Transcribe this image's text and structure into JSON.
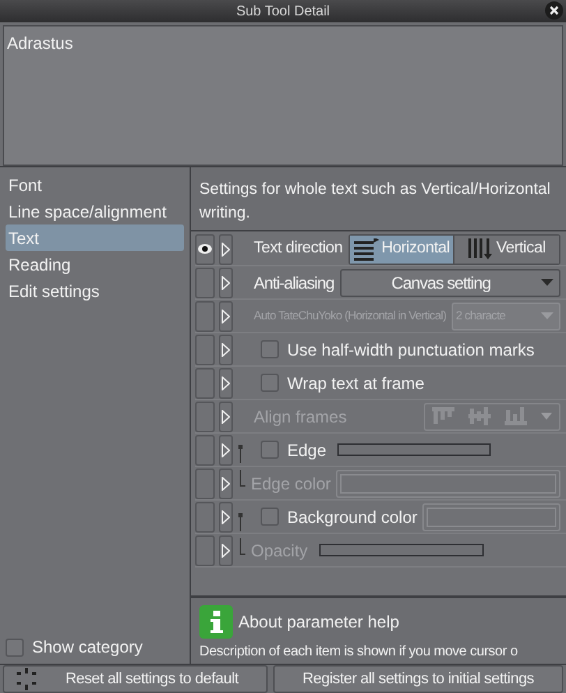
{
  "window": {
    "title": "Sub Tool Detail"
  },
  "preview": {
    "name": "Adrastus"
  },
  "categories": [
    {
      "label": "Font",
      "selected": false
    },
    {
      "label": "Line space/alignment",
      "selected": false
    },
    {
      "label": "Text",
      "selected": true
    },
    {
      "label": "Reading",
      "selected": false
    },
    {
      "label": "Edit settings",
      "selected": false
    }
  ],
  "show_category": {
    "label": "Show category",
    "checked": false
  },
  "description": "Settings for whole text such as Vertical/Horizontal writing.",
  "settings": [
    {
      "kind": "segmented",
      "label": "Text direction",
      "visible": true,
      "disabled": false,
      "options": [
        {
          "label": "Horizontal",
          "selected": true
        },
        {
          "label": "Vertical",
          "selected": false
        }
      ]
    },
    {
      "kind": "select",
      "label": "Anti-aliasing",
      "value": "Canvas setting",
      "visible": false,
      "disabled": false
    },
    {
      "kind": "select",
      "label": "Auto TateChuYoko (Horizontal in Vertical)",
      "value": "2 characte",
      "visible": false,
      "disabled": true
    },
    {
      "kind": "checkbox",
      "label": "Use half-width punctuation marks",
      "checked": false,
      "visible": false,
      "disabled": false
    },
    {
      "kind": "checkbox",
      "label": "Wrap text at frame",
      "checked": false,
      "visible": false,
      "disabled": false
    },
    {
      "kind": "icons",
      "label": "Align frames",
      "visible": false,
      "disabled": true
    },
    {
      "kind": "checkbox-slider",
      "label": "Edge",
      "checked": false,
      "visible": false,
      "disabled": false,
      "children": [
        {
          "kind": "color",
          "label": "Edge color",
          "visible": false,
          "disabled": true
        }
      ]
    },
    {
      "kind": "checkbox-color",
      "label": "Background color",
      "checked": false,
      "visible": false,
      "disabled": false,
      "children": [
        {
          "kind": "slider",
          "label": "Opacity",
          "visible": false,
          "disabled": true
        }
      ]
    }
  ],
  "help": {
    "title": "About parameter help",
    "text": "Description of each item is shown if you move cursor o"
  },
  "buttons": [
    {
      "kind": "reset",
      "label": "Reset all settings to default"
    },
    {
      "kind": "plain",
      "label": "Register all settings to initial settings"
    }
  ]
}
